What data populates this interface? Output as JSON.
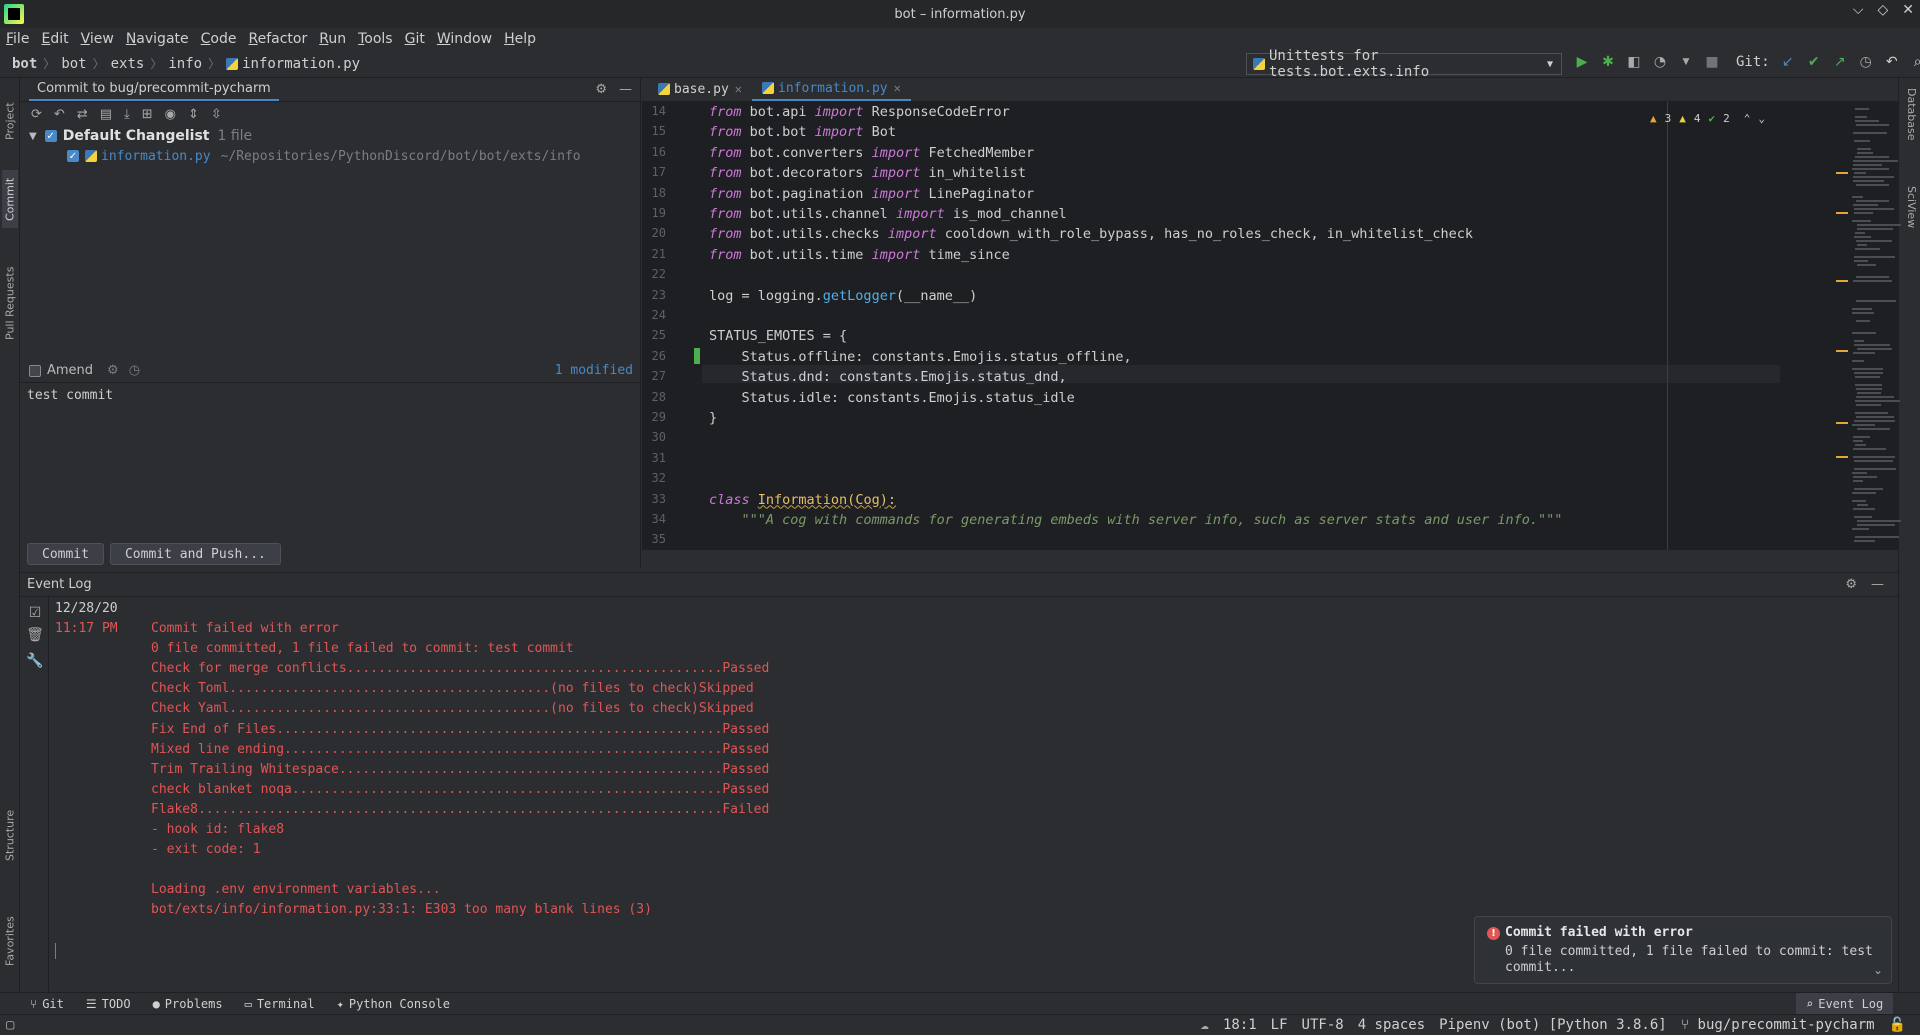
{
  "window": {
    "title": "bot – information.py",
    "controls": [
      "⌵",
      "◇",
      "✕"
    ]
  },
  "menu": [
    "File",
    "Edit",
    "View",
    "Navigate",
    "Code",
    "Refactor",
    "Run",
    "Tools",
    "Git",
    "Window",
    "Help"
  ],
  "breadcrumb": [
    "bot",
    "bot",
    "exts",
    "info",
    "information.py"
  ],
  "run_config": "Unittests for tests.bot.exts.info",
  "git_label": "Git:",
  "left_tabs": [
    "Project",
    "Commit",
    "Pull Requests",
    "Structure",
    "Favorites"
  ],
  "right_tabs": [
    "Database",
    "SciView"
  ],
  "commit_panel": {
    "tab_title": "Commit to bug/precommit-pycharm",
    "changelist_name": "Default Changelist",
    "changelist_count": "1 file",
    "file_name": "information.py",
    "file_path": "~/Repositories/PythonDiscord/bot/bot/exts/info",
    "amend_label": "Amend",
    "modified_count": "1 modified",
    "message": "test commit",
    "commit_button": "Commit",
    "commit_push_button": "Commit and Push..."
  },
  "editor": {
    "tabs": [
      {
        "label": "base.py",
        "active": false
      },
      {
        "label": "information.py",
        "active": true
      }
    ],
    "inspections": {
      "errors": "3",
      "warnings": "4",
      "ok": "2"
    },
    "line_numbers": [
      "14",
      "15",
      "16",
      "17",
      "18",
      "19",
      "20",
      "21",
      "22",
      "23",
      "24",
      "25",
      "26",
      "27",
      "28",
      "29",
      "30",
      "31",
      "32",
      "33",
      "34",
      "35"
    ],
    "lines": [
      [
        [
          "kw",
          "from"
        ],
        [
          "t",
          " bot.api "
        ],
        [
          "kw",
          "import"
        ],
        [
          "t",
          " ResponseCodeError"
        ]
      ],
      [
        [
          "kw",
          "from"
        ],
        [
          "t",
          " bot.bot "
        ],
        [
          "kw",
          "import"
        ],
        [
          "t",
          " Bot"
        ]
      ],
      [
        [
          "kw",
          "from"
        ],
        [
          "t",
          " bot.converters "
        ],
        [
          "kw",
          "import"
        ],
        [
          "t",
          " FetchedMember"
        ]
      ],
      [
        [
          "kw",
          "from"
        ],
        [
          "t",
          " bot.decorators "
        ],
        [
          "kw",
          "import"
        ],
        [
          "t",
          " in_whitelist"
        ]
      ],
      [
        [
          "kw",
          "from"
        ],
        [
          "t",
          " bot.pagination "
        ],
        [
          "kw",
          "import"
        ],
        [
          "t",
          " LinePaginator"
        ]
      ],
      [
        [
          "kw",
          "from"
        ],
        [
          "t",
          " bot.utils.channel "
        ],
        [
          "kw",
          "import"
        ],
        [
          "t",
          " is_mod_channel"
        ]
      ],
      [
        [
          "kw",
          "from"
        ],
        [
          "t",
          " bot.utils.checks "
        ],
        [
          "kw",
          "import"
        ],
        [
          "t",
          " cooldown_with_role_bypass, has_no_roles_check, in_whitelist_check"
        ]
      ],
      [
        [
          "kw",
          "from"
        ],
        [
          "t",
          " bot.utils.time "
        ],
        [
          "kw",
          "import"
        ],
        [
          "t",
          " time_since"
        ]
      ],
      [],
      [
        [
          "t",
          "log = logging."
        ],
        [
          "fn",
          "getLogger"
        ],
        [
          "t",
          "(__name__)"
        ]
      ],
      [],
      [
        [
          "t",
          "STATUS_EMOTES = {"
        ]
      ],
      [
        [
          "t",
          "    Status.offline: constants.Emojis.status_offline,"
        ]
      ],
      [
        [
          "t",
          "    Status.dnd: constants.Emojis.status_dnd,"
        ]
      ],
      [
        [
          "t",
          "    Status.idle: constants.Emojis.status_idle"
        ]
      ],
      [
        [
          "t",
          "}"
        ]
      ],
      [],
      [],
      [],
      [
        [
          "kw",
          "class"
        ],
        [
          "t",
          " "
        ],
        [
          "cls",
          "Information(Cog):"
        ]
      ],
      [
        [
          "doc",
          "    \"\"\"A cog with commands for generating embeds with server info, such as server stats and user info.\"\"\""
        ]
      ],
      []
    ]
  },
  "event_log": {
    "title": "Event Log",
    "date": "12/28/20",
    "time": "11:17 PM",
    "lines": [
      "Commit failed with error",
      "0 file committed, 1 file failed to commit: test commit",
      "Check for merge conflicts................................................Passed",
      "Check Toml.........................................(no files to check)Skipped",
      "Check Yaml.........................................(no files to check)Skipped",
      "Fix End of Files.........................................................Passed",
      "Mixed line ending........................................................Passed",
      "Trim Trailing Whitespace.................................................Passed",
      "check blanket noqa.......................................................Passed",
      "Flake8...................................................................Failed",
      "- hook id: flake8",
      "- exit code: 1",
      "",
      "Loading .env environment variables...",
      "bot/exts/info/information.py:33:1: E303 too many blank lines (3)"
    ]
  },
  "notification": {
    "title": "Commit failed with error",
    "body": "0 file committed, 1 file failed to commit: test commit..."
  },
  "tool_windows": [
    "Git",
    "TODO",
    "Problems",
    "Terminal",
    "Python Console"
  ],
  "event_log_button": "Event Log",
  "status": {
    "position": "18:1",
    "line_sep": "LF",
    "encoding": "UTF-8",
    "indent": "4 spaces",
    "interpreter": "Pipenv (bot) [Python 3.8.6]",
    "branch": "bug/precommit-pycharm"
  },
  "colors": {
    "accent": "#4a88c7",
    "error": "#e05555",
    "keyword": "#cc78d8",
    "function": "#4fb0e8"
  }
}
